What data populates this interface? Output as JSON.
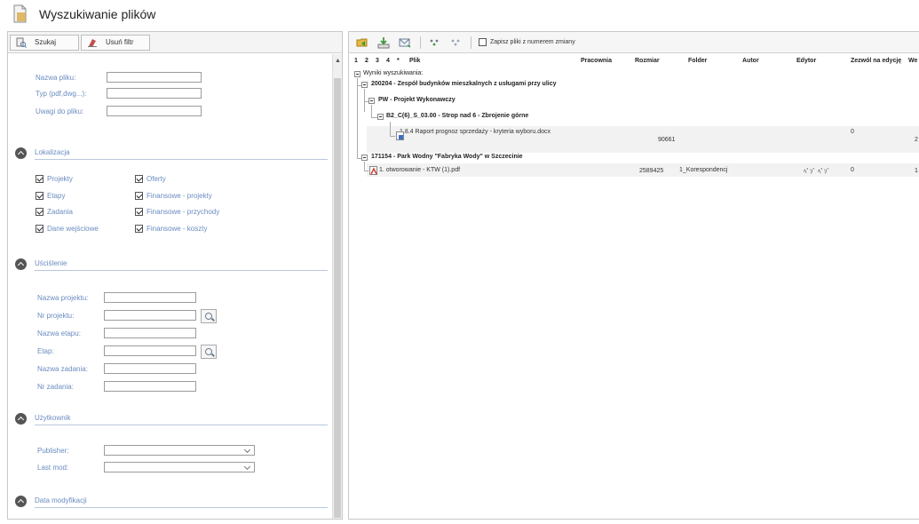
{
  "window": {
    "title": "Wyszukiwanie plików"
  },
  "left_toolbar": {
    "search_label": "Szukaj",
    "clear_label": "Usuń filtr"
  },
  "file_fields": {
    "name_label": "Nazwa pliku:",
    "name_value": "",
    "type_label": "Typ (pdf,dwg...):",
    "type_value": "",
    "notes_label": "Uwagi do pliku:",
    "notes_value": ""
  },
  "sections": {
    "location": "Lokalizacja",
    "refine": "Uściślenie",
    "user": "Użytkownik",
    "modified": "Data modyfikacji"
  },
  "location_checks": {
    "projects": "Projekty",
    "offers": "Oferty",
    "stages": "Etapy",
    "fin_projects": "Finansowe - projekty",
    "tasks": "Zadania",
    "fin_income": "Finansowe - przychody",
    "input_data": "Dane wejściowe",
    "fin_costs": "Finansowe - koszty"
  },
  "refine_fields": {
    "project_name": "Nazwa projektu:",
    "project_no": "Nr projektu:",
    "stage_name": "Nazwa etapu:",
    "stage": "Etap:",
    "task_name": "Nazwa zadania:",
    "task_no": "Nr zadania:"
  },
  "user_fields": {
    "publisher": "Publisher:",
    "last_mod": "Last mod:"
  },
  "right_toolbar": {
    "save_changes_label": "Zapisz pliki z numerem zmiany"
  },
  "columns": {
    "c1": "1",
    "c2": "2",
    "c3": "3",
    "c4": "4",
    "c5": "*",
    "file": "Plik",
    "studio": "Pracownia",
    "size": "Rozmiar",
    "folder": "Folder",
    "author": "Autor",
    "editor": "Edytor",
    "allow_edit": "Zezwól na edycję",
    "last": "We"
  },
  "tree": {
    "root": "Wyniki wyszukiwania:",
    "project1": "200204 - Zespół budynków mieszkalnych z usługami przy ulicy",
    "phase1": "PW - Projekt Wykonawczy",
    "stage1": "B2_C(6)_S_03.00 - Strop nad 6 - Zbrojenie górne",
    "file1": "1.8.4 Raport prognoz sprzedaży - kryteria wyboru.docx",
    "file1_size": "90661",
    "file1_allow": "0",
    "file1_last": "2",
    "project2": "171154 - Park Wodny \"Fabryka Wody\" w Szczecinie",
    "file2": "1. otworowanie - KTW (1).pdf",
    "file2_size": "2589425",
    "file2_folder": "1_Korespondencj",
    "file2_author_editor": "ﾍﾟｿﾞ ﾍﾟｿﾞ",
    "file2_allow": "0",
    "file2_last": "1"
  }
}
